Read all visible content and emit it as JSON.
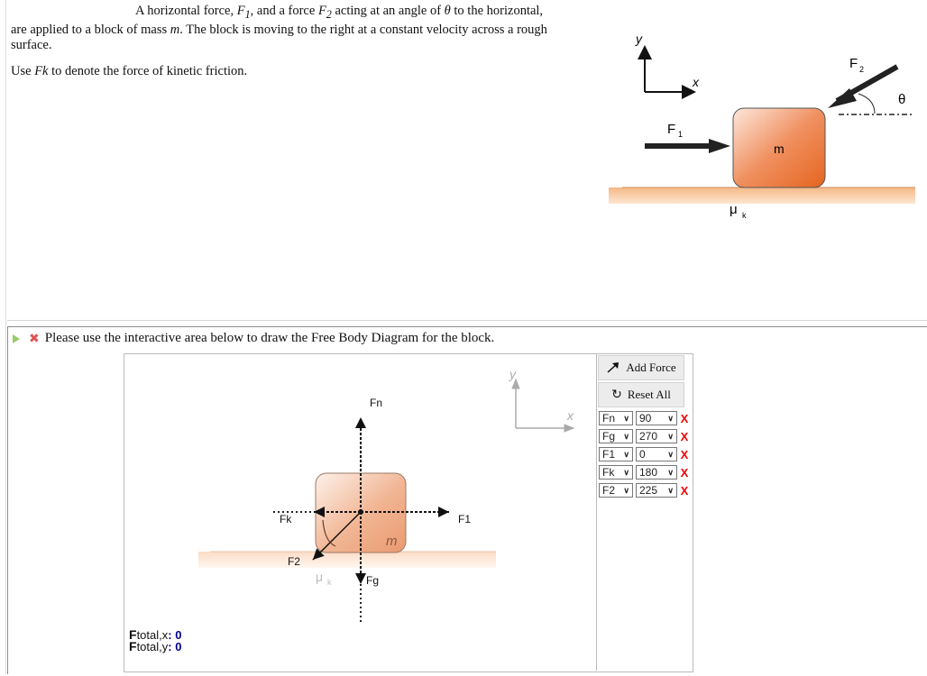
{
  "question": {
    "line1_a": "A horizontal force, ",
    "f1": "F",
    "f1_sub": "1",
    "line1_b": ", and a force ",
    "f2": "F",
    "f2_sub": "2",
    "line1_c": " acting at an angle of ",
    "theta": "θ",
    "line1_d": " to the horizontal,",
    "line2_a": "are applied to a block of mass ",
    "mass": "m",
    "line2_b": ". The block is moving to the right at a constant velocity across a rough surface.",
    "use_a": "Use ",
    "fk": "Fk",
    "use_b": " to denote the force of kinetic friction."
  },
  "figure": {
    "y_label": "y",
    "x_label": "x",
    "f1_label": "F",
    "f1_sub": "1",
    "f2_label": "F",
    "f2_sub": "2",
    "theta_label": "θ",
    "mass_label": "m",
    "mu_label": "μ",
    "mu_sub": "k",
    "colors": {
      "block": "#e8743a",
      "ground": "#f6c9a0"
    }
  },
  "prompt": {
    "text": "Please use the interactive area below to draw the Free Body Diagram for the block.",
    "status": "incorrect"
  },
  "fbd": {
    "axis_y": "y",
    "axis_x": "x",
    "mass_label": "m",
    "mu_label": "μ",
    "mu_sub": "k",
    "forces": [
      {
        "name": "Fn",
        "angle": 90
      },
      {
        "name": "Fg",
        "angle": 270
      },
      {
        "name": "F1",
        "angle": 0
      },
      {
        "name": "Fk",
        "angle": 180
      },
      {
        "name": "F2",
        "angle": 225
      }
    ],
    "totals": {
      "x_label": "total,x",
      "y_label": "total,y",
      "F": "F",
      "x_value": "0",
      "y_value": "0"
    }
  },
  "toolbar": {
    "add_force": "Add Force",
    "reset_all": "Reset All",
    "delete_glyph": "X"
  }
}
